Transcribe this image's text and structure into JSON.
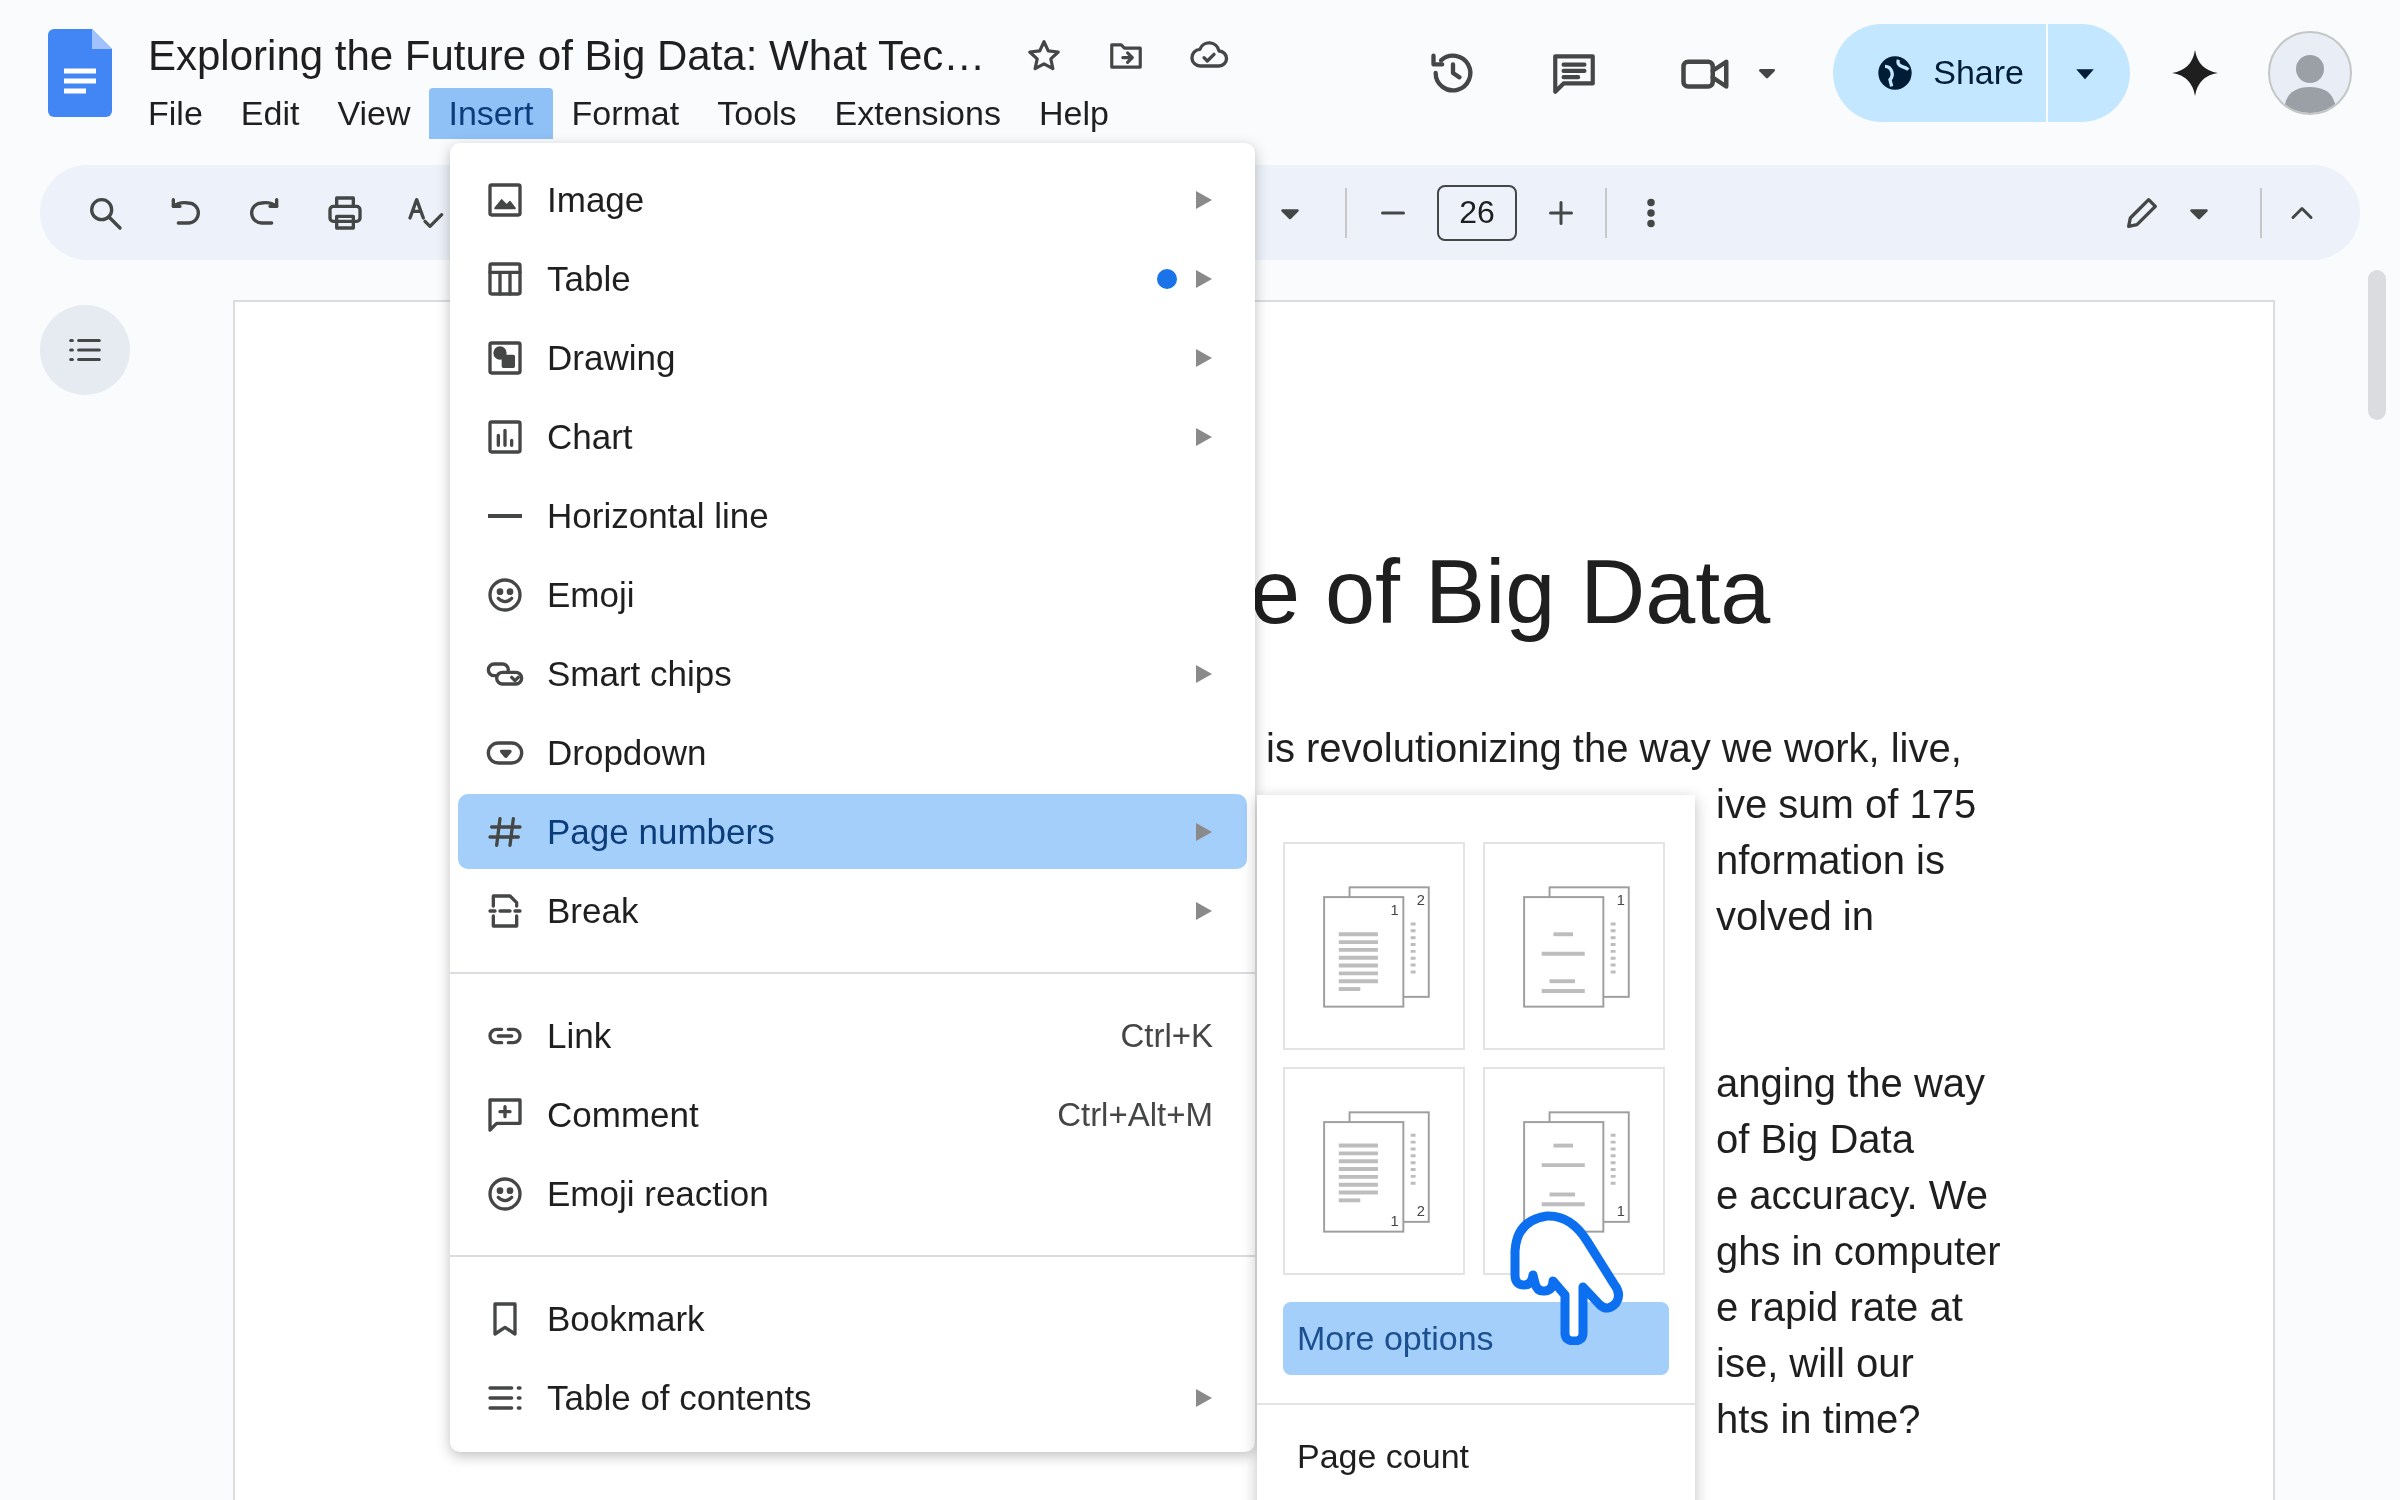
{
  "app": {
    "title": "Exploring the Future of Big Data: What Tec…",
    "menus": [
      {
        "label": "File",
        "selected": false
      },
      {
        "label": "Edit",
        "selected": false
      },
      {
        "label": "View",
        "selected": false
      },
      {
        "label": "Insert",
        "selected": true
      },
      {
        "label": "Format",
        "selected": false
      },
      {
        "label": "Tools",
        "selected": false
      },
      {
        "label": "Extensions",
        "selected": false
      },
      {
        "label": "Help",
        "selected": false
      }
    ],
    "share": "Share"
  },
  "toolbar": {
    "font_size": "26"
  },
  "document": {
    "heading": "e of Big Data",
    "paragraphs": [
      [
        "is revolutionizing the way we work, live,",
        "ive sum of 175",
        "nformation is",
        "volved in"
      ],
      [
        "anging the way",
        "of Big Data",
        "e accuracy. We",
        "ghs in computer",
        "e rapid rate at",
        "ise, will our",
        "hts in time?"
      ]
    ]
  },
  "insert_menu": {
    "sections": [
      [
        {
          "label": "Image",
          "submenu": true,
          "new": false,
          "selected": false
        },
        {
          "label": "Table",
          "submenu": true,
          "new": true,
          "selected": false
        },
        {
          "label": "Drawing",
          "submenu": true,
          "new": false,
          "selected": false
        },
        {
          "label": "Chart",
          "submenu": true,
          "new": false,
          "selected": false
        },
        {
          "label": "Horizontal line",
          "submenu": false,
          "new": false,
          "selected": false
        },
        {
          "label": "Emoji",
          "submenu": false,
          "new": false,
          "selected": false
        },
        {
          "label": "Smart chips",
          "submenu": true,
          "new": false,
          "selected": false
        },
        {
          "label": "Dropdown",
          "submenu": false,
          "new": false,
          "selected": false
        },
        {
          "label": "Page numbers",
          "submenu": true,
          "new": false,
          "selected": true
        },
        {
          "label": "Break",
          "submenu": true,
          "new": false,
          "selected": false
        }
      ],
      [
        {
          "label": "Link",
          "shortcut": "Ctrl+K",
          "submenu": false,
          "new": false,
          "selected": false
        },
        {
          "label": "Comment",
          "shortcut": "Ctrl+Alt+M",
          "submenu": false,
          "new": false,
          "selected": false
        },
        {
          "label": "Emoji reaction",
          "submenu": false,
          "new": false,
          "selected": false
        }
      ],
      [
        {
          "label": "Bookmark",
          "submenu": false,
          "new": false,
          "selected": false
        },
        {
          "label": "Table of contents",
          "submenu": true,
          "new": false,
          "selected": false
        }
      ]
    ]
  },
  "page_numbers_submenu": {
    "options": [
      {
        "bottom": false,
        "front": "1",
        "back": "2"
      },
      {
        "bottom": false,
        "back": "1"
      },
      {
        "bottom": true,
        "front": "1",
        "back": "2"
      },
      {
        "bottom": true,
        "back": "1"
      }
    ],
    "more_options": {
      "label": "More options",
      "selected": true
    },
    "page_count": "Page count"
  }
}
